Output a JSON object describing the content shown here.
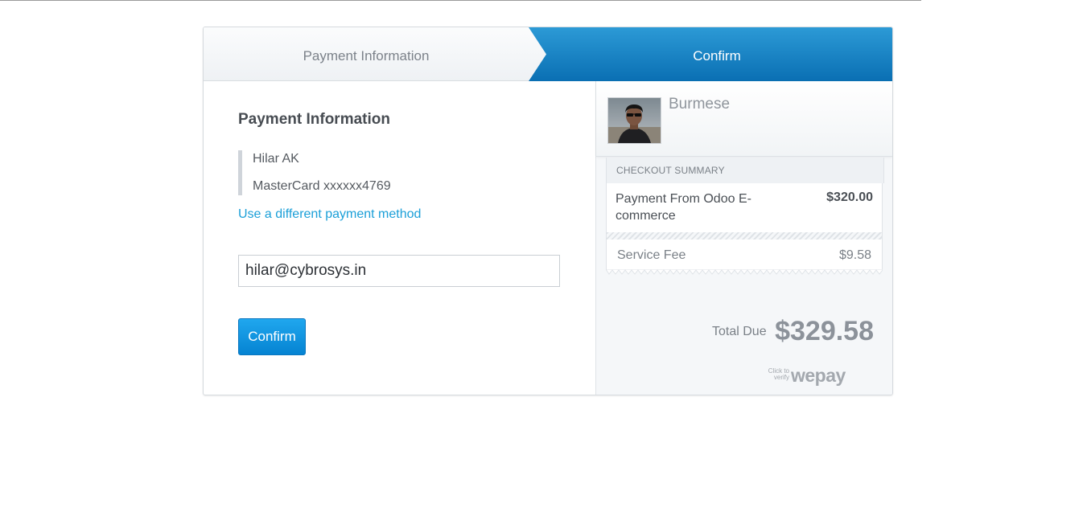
{
  "steps": {
    "step1_label": "Payment Information",
    "step2_label": "Confirm",
    "active_color": "#0f7cc0",
    "inactive_color": "#f3f5f7"
  },
  "payment": {
    "title": "Payment Information",
    "name": "Hilar AK",
    "card": "MasterCard xxxxxx4769",
    "different_method_link": "Use a different payment method",
    "email_value": "hilar@cybrosys.in",
    "confirm_label": "Confirm"
  },
  "merchant": {
    "name": "Burmese"
  },
  "summary": {
    "title": "CHECKOUT SUMMARY",
    "item_description": "Payment From Odoo E-commerce",
    "item_amount": "$320.00",
    "fee_label": "Service Fee",
    "fee_amount": "$9.58",
    "total_label": "Total Due",
    "total_amount": "$329.58"
  },
  "branding": {
    "verify_text": "Click to verify",
    "logo_text": "wepay"
  }
}
